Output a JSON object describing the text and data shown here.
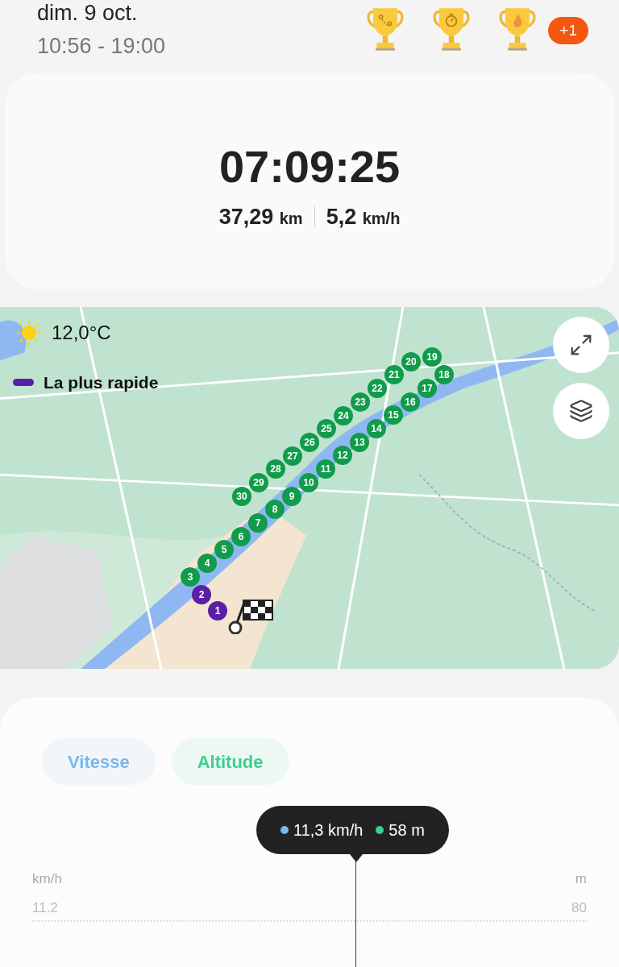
{
  "header": {
    "date": "dim. 9 oct.",
    "time_range": "10:56 - 19:00",
    "trophies": [
      {
        "kind": "route"
      },
      {
        "kind": "timer"
      },
      {
        "kind": "fire"
      }
    ],
    "more_badge": "+1"
  },
  "summary": {
    "duration": "07:09:25",
    "distance": "37,29",
    "distance_unit": "km",
    "speed": "5,2",
    "speed_unit": "km/h"
  },
  "map": {
    "weather": "12,0°C",
    "legend": {
      "label": "La plus rapide",
      "color": "#5b1fa6"
    },
    "markers": [
      {
        "label": "1",
        "color": "#5b1fa6"
      },
      {
        "label": "2",
        "color": "#5b1fa6"
      },
      {
        "label": "3",
        "color": "#119c4b"
      },
      {
        "label": "4",
        "color": "#119c4b"
      },
      {
        "label": "5",
        "color": "#119c4b"
      },
      {
        "label": "6",
        "color": "#119c4b"
      },
      {
        "label": "7",
        "color": "#119c4b"
      },
      {
        "label": "8",
        "color": "#119c4b"
      },
      {
        "label": "9",
        "color": "#119c4b"
      },
      {
        "label": "10",
        "color": "#119c4b"
      },
      {
        "label": "11",
        "color": "#119c4b"
      },
      {
        "label": "12",
        "color": "#119c4b"
      },
      {
        "label": "13",
        "color": "#119c4b"
      },
      {
        "label": "14",
        "color": "#119c4b"
      },
      {
        "label": "15",
        "color": "#119c4b"
      },
      {
        "label": "16",
        "color": "#119c4b"
      },
      {
        "label": "17",
        "color": "#119c4b"
      },
      {
        "label": "18",
        "color": "#119c4b"
      },
      {
        "label": "19",
        "color": "#119c4b"
      },
      {
        "label": "20",
        "color": "#119c4b"
      },
      {
        "label": "21",
        "color": "#119c4b"
      },
      {
        "label": "22",
        "color": "#119c4b"
      },
      {
        "label": "23",
        "color": "#119c4b"
      },
      {
        "label": "24",
        "color": "#119c4b"
      },
      {
        "label": "25",
        "color": "#119c4b"
      },
      {
        "label": "26",
        "color": "#119c4b"
      },
      {
        "label": "27",
        "color": "#119c4b"
      },
      {
        "label": "28",
        "color": "#119c4b"
      },
      {
        "label": "29",
        "color": "#119c4b"
      },
      {
        "label": "30",
        "color": "#119c4b"
      }
    ]
  },
  "chart": {
    "toggles": [
      {
        "label": "Vitesse",
        "on": true,
        "color": "#7ab8ec"
      },
      {
        "label": "Altitude",
        "on": true,
        "color": "#3ccf8e"
      }
    ],
    "tooltip": [
      {
        "text": "11,3 km/h",
        "color": "#7ab8ec"
      },
      {
        "text": "58 m",
        "color": "#3ccf8e"
      }
    ],
    "left_unit": "km/h",
    "right_unit": "m",
    "left_tick": "11.2",
    "right_tick": "80"
  }
}
